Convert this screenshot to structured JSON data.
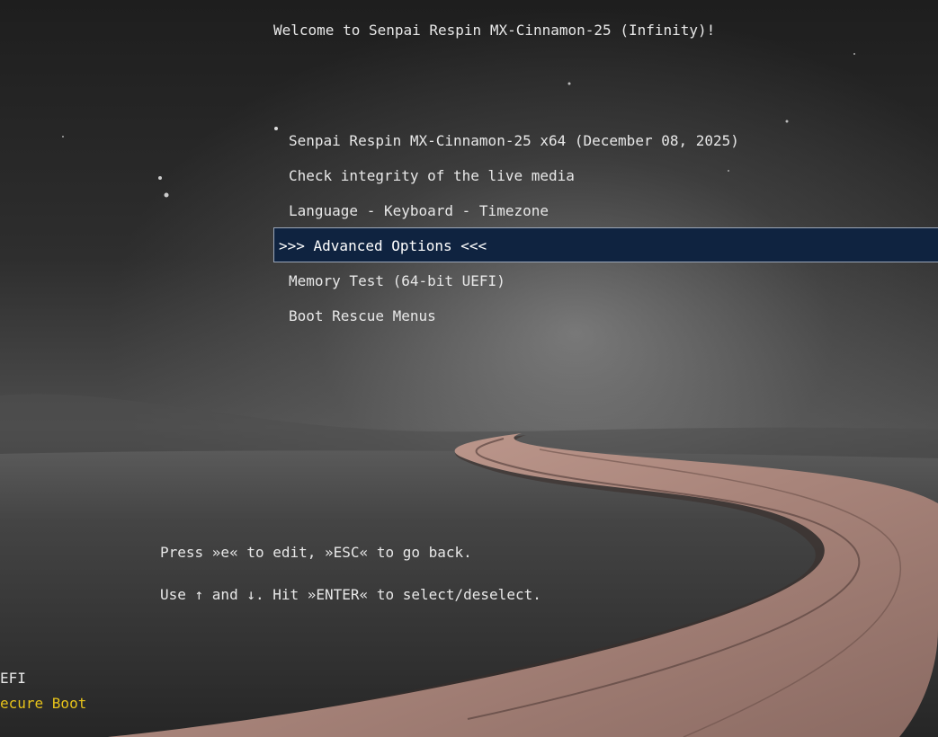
{
  "header": {
    "title": "Welcome to Senpai Respin MX-Cinnamon-25 (Infinity)!"
  },
  "menu": {
    "items": [
      {
        "label": "Senpai Respin MX-Cinnamon-25 x64 (December 08, 2025)",
        "selected": false
      },
      {
        "label": "Check integrity of the live media",
        "selected": false
      },
      {
        "label": "Language - Keyboard - Timezone",
        "selected": false
      },
      {
        "label": ">>> Advanced Options <<<",
        "selected": true
      },
      {
        "label": "Memory Test (64-bit UEFI)",
        "selected": false
      },
      {
        "label": "Boot Rescue Menus",
        "selected": false
      }
    ],
    "highlight_color": "#0f2340"
  },
  "help": {
    "line1": "Press »e« to edit, »ESC« to go back.",
    "line2": "Use ↑ and ↓. Hit »ENTER« to select/deselect."
  },
  "status": {
    "mode": "EFI",
    "secure_boot": "ecure Boot",
    "secure_boot_color": "#e6c21a"
  }
}
